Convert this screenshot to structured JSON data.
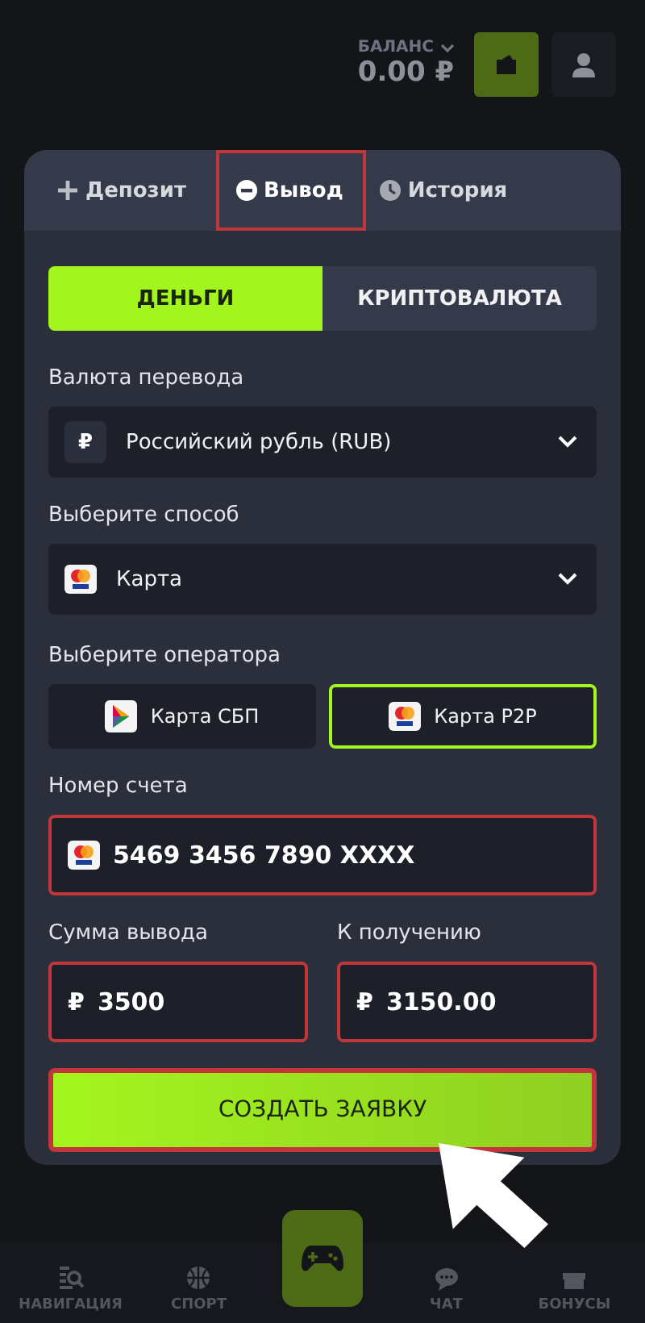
{
  "header": {
    "balance_label": "БАЛАНС",
    "balance": "0.00 ₽"
  },
  "tabs": [
    {
      "label": "Депозит",
      "selected": false,
      "highlighted": false
    },
    {
      "label": "Вывод",
      "selected": true,
      "highlighted": true
    },
    {
      "label": "История",
      "selected": false,
      "highlighted": false
    }
  ],
  "mode_tabs": [
    {
      "label": "ДЕНЬГИ",
      "selected": true
    },
    {
      "label": "КРИПТОВАЛЮТА",
      "selected": false
    }
  ],
  "currency": {
    "label": "Валюта перевода",
    "symbol": "₽",
    "value": "Российский рубль (RUB)"
  },
  "method": {
    "label": "Выберите способ",
    "value": "Карта"
  },
  "operators": {
    "label": "Выберите оператора",
    "items": [
      {
        "label": "Карта СБП",
        "selected": false
      },
      {
        "label": "Карта P2P",
        "selected": true
      }
    ]
  },
  "account": {
    "label": "Номер счета",
    "value": "5469 3456 7890 XXXX",
    "highlighted": true
  },
  "amounts": [
    {
      "label": "Сумма вывода",
      "symbol": "₽",
      "value": "3500",
      "highlighted": true
    },
    {
      "label": "К получению",
      "symbol": "₽",
      "value": "3150.00",
      "highlighted": true
    }
  ],
  "submit": {
    "label": "СОЗДАТЬ ЗАЯВКУ",
    "highlighted": true
  },
  "bottom_nav": [
    {
      "label": "НАВИГАЦИЯ"
    },
    {
      "label": "СПОРТ"
    },
    {
      "label": "ЧАТ"
    },
    {
      "label": "БОНУСЫ"
    }
  ]
}
